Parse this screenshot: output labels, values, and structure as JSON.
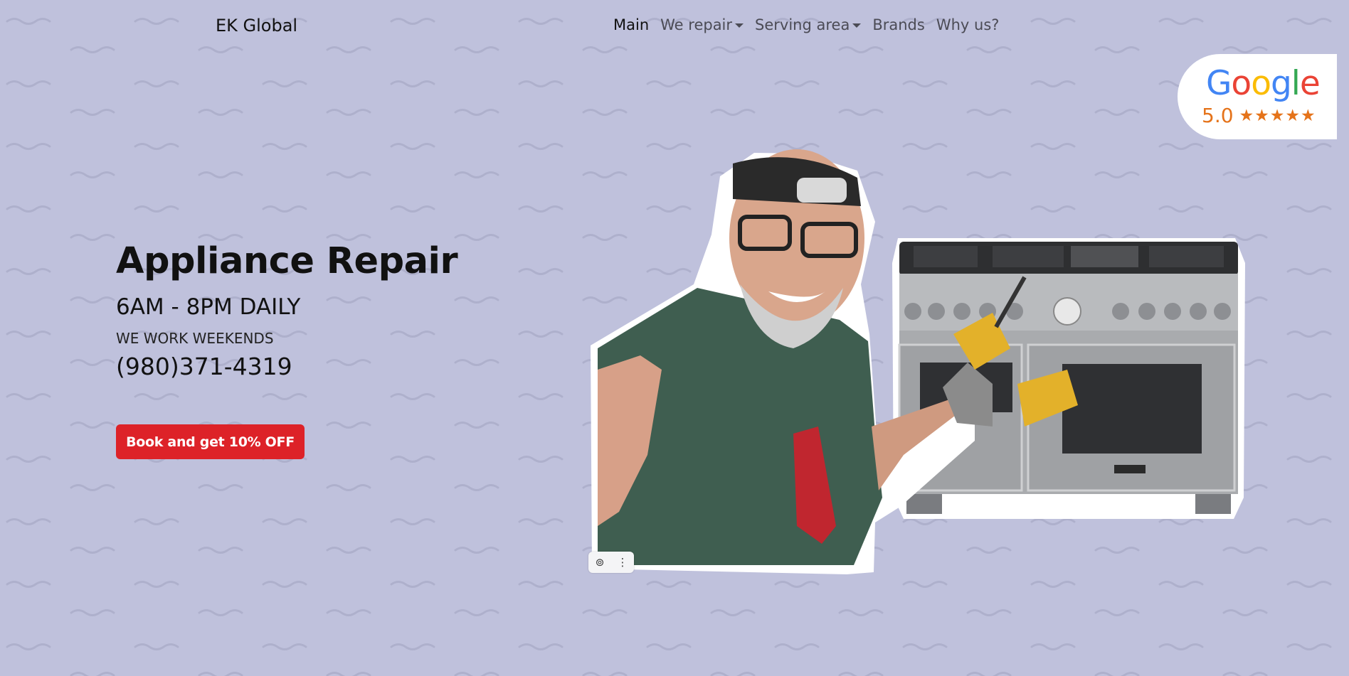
{
  "brand": "EK Global",
  "nav": {
    "items": [
      {
        "label": "Main",
        "active": true,
        "dropdown": false
      },
      {
        "label": "We repair",
        "active": false,
        "dropdown": true
      },
      {
        "label": "Serving area",
        "active": false,
        "dropdown": true
      },
      {
        "label": "Brands",
        "active": false,
        "dropdown": false
      },
      {
        "label": "Why us?",
        "active": false,
        "dropdown": false
      }
    ]
  },
  "google_badge": {
    "logo_letters": [
      "G",
      "o",
      "o",
      "g",
      "l",
      "e"
    ],
    "logo_colors": [
      "#4285F4",
      "#EA4335",
      "#FBBC05",
      "#4285F4",
      "#34A853",
      "#EA4335"
    ],
    "rating": "5.0",
    "stars": "★★★★★"
  },
  "hero": {
    "title": "Appliance Repair",
    "hours": "6AM - 8PM DAILY",
    "weekends": "WE WORK WEEKENDS",
    "phone": "(980)371-4319",
    "cta_label": "Book and get 10% OFF"
  },
  "image_tools": {
    "icons": [
      "lens-icon",
      "more-vertical-icon"
    ]
  },
  "colors": {
    "background": "#bfc1dc",
    "cta": "#dd2228",
    "rating": "#e5731a"
  }
}
